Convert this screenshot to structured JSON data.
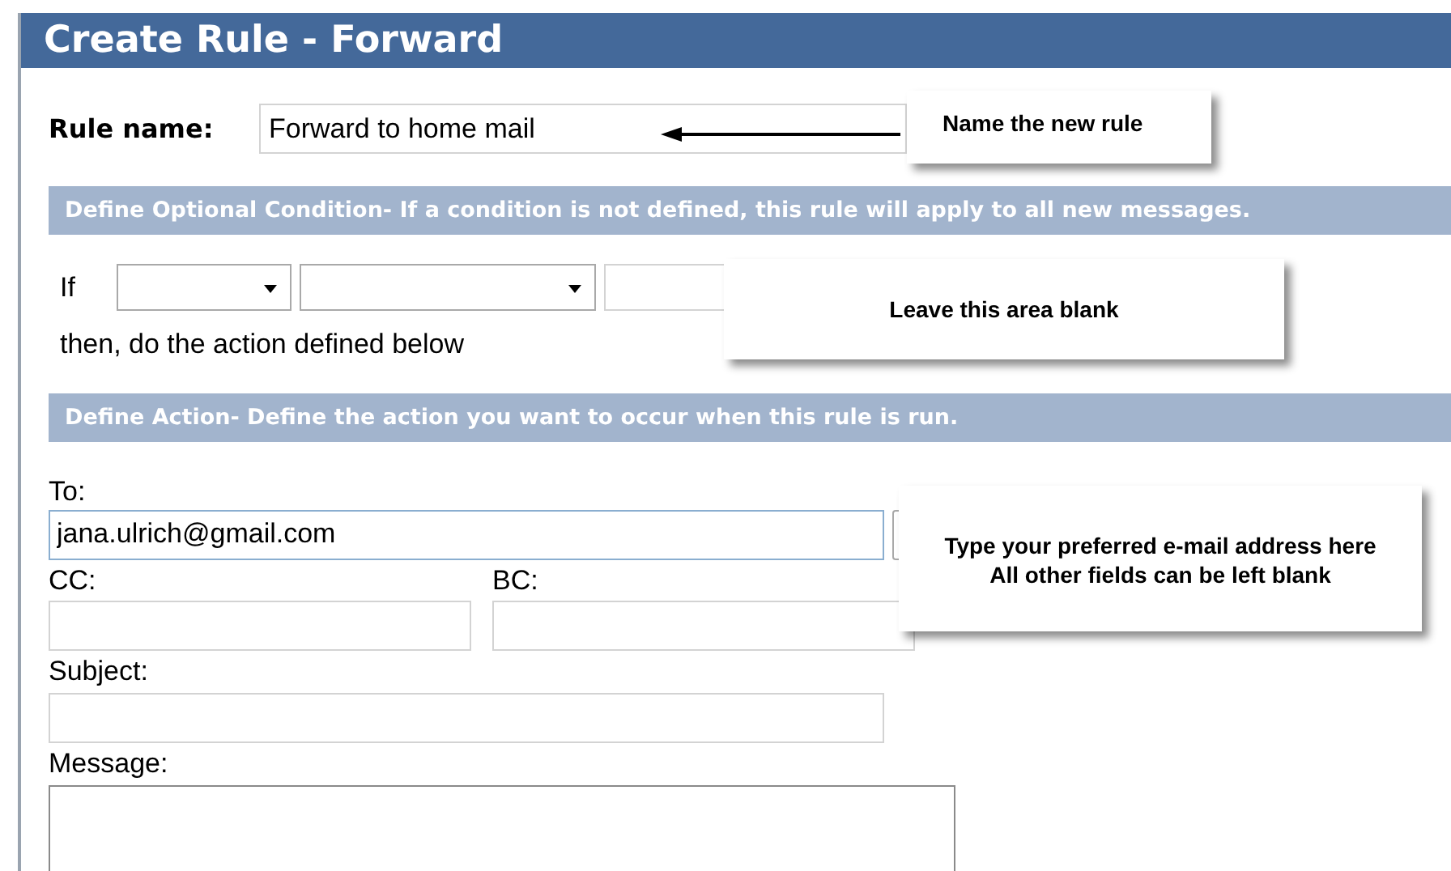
{
  "window": {
    "title": "Create Rule - Forward"
  },
  "rule_name": {
    "label": "Rule name:",
    "value": "Forward to home mail"
  },
  "condition_section": {
    "heading": "Define Optional Condition- If a condition is not defined, this rule will apply to all new messages."
  },
  "condition": {
    "prefix": "If",
    "then_text": "then, do the action defined below"
  },
  "action_section": {
    "heading": "Define Action- Define the action you want to occur when this rule is run."
  },
  "to": {
    "label": "To:",
    "value": "jana.ulrich@gmail.com"
  },
  "cc": {
    "label": "CC:"
  },
  "bc": {
    "label": "BC:"
  },
  "subject": {
    "label": "Subject:"
  },
  "message": {
    "label": "Message:"
  },
  "callouts": [
    {
      "lines": [
        "Name the new rule"
      ]
    },
    {
      "lines": [
        "Leave this area blank"
      ]
    },
    {
      "lines": [
        "Type your preferred e-mail address here",
        "All other fields can be left blank"
      ]
    }
  ]
}
